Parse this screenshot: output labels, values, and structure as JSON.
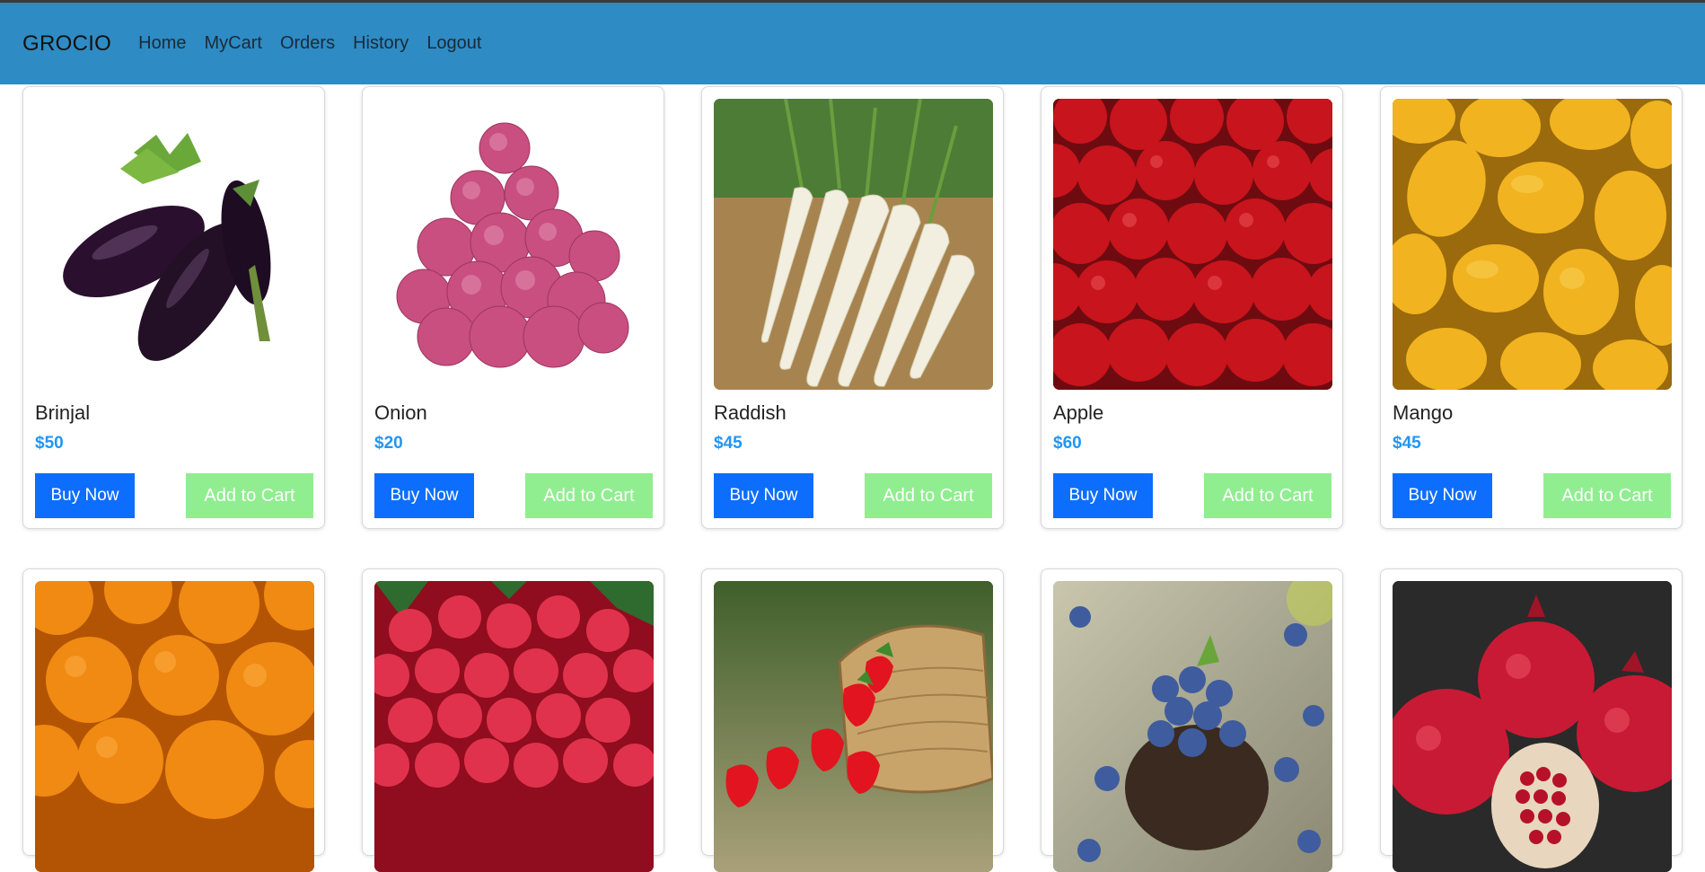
{
  "navbar": {
    "brand": "GROCIO",
    "links": [
      "Home",
      "MyCart",
      "Orders",
      "History",
      "Logout"
    ]
  },
  "buttons": {
    "buy": "Buy Now",
    "cart": "Add to Cart"
  },
  "products": [
    {
      "name": "Brinjal",
      "price": "$50",
      "image": "brinjal-image"
    },
    {
      "name": "Onion",
      "price": "$20",
      "image": "onion-image"
    },
    {
      "name": "Raddish",
      "price": "$45",
      "image": "radish-image"
    },
    {
      "name": "Apple",
      "price": "$60",
      "image": "apple-image"
    },
    {
      "name": "Mango",
      "price": "$45",
      "image": "mango-image"
    },
    {
      "image": "orange-image"
    },
    {
      "image": "lychee-image"
    },
    {
      "image": "strawberry-image"
    },
    {
      "image": "blueberry-image"
    },
    {
      "image": "pomegranate-image"
    }
  ],
  "colors": {
    "navbar": "#2e8bc4",
    "buy_button": "#0d6efd",
    "cart_button": "#90ee90",
    "price": "#2196f3"
  }
}
